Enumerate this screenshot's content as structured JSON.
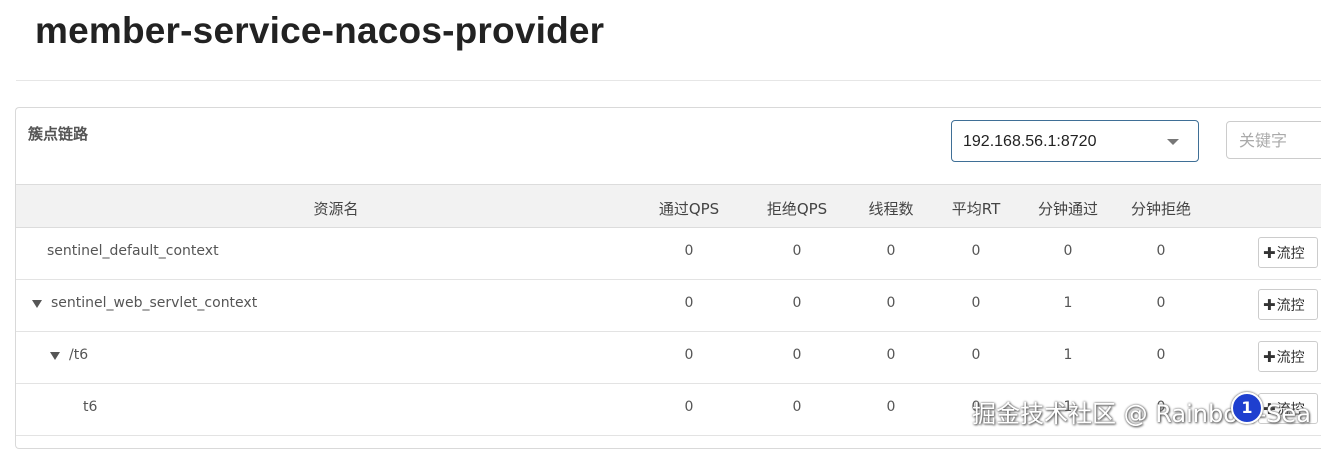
{
  "page": {
    "title": "member-service-nacos-provider"
  },
  "panel": {
    "title": "簇点链路",
    "machine_select": {
      "value": "192.168.56.1:8720"
    },
    "search": {
      "placeholder": "关键字"
    }
  },
  "table": {
    "headers": [
      "资源名",
      "通过QPS",
      "拒绝QPS",
      "线程数",
      "平均RT",
      "分钟通过",
      "分钟拒绝"
    ],
    "rows": [
      {
        "name": "sentinel_default_context",
        "expanded": null,
        "values": [
          "0",
          "0",
          "0",
          "0",
          "0",
          "0"
        ],
        "action": "流控"
      },
      {
        "name": "sentinel_web_servlet_context",
        "expanded": true,
        "values": [
          "0",
          "0",
          "0",
          "0",
          "1",
          "0"
        ],
        "action": "流控"
      },
      {
        "name": "/t6",
        "expanded": true,
        "values": [
          "0",
          "0",
          "0",
          "0",
          "1",
          "0"
        ],
        "action": "流控"
      },
      {
        "name": "t6",
        "expanded": null,
        "values": [
          "0",
          "0",
          "0",
          "0",
          "1",
          "0"
        ],
        "action": "流控"
      }
    ]
  },
  "overlay": {
    "watermark": "掘金技术社区 @ Rainbow-Sea",
    "badge_count": "1"
  },
  "colors": {
    "select_border": "#3f6f96",
    "header_bg": "#f2f2f2",
    "badge": "#1e3fcf"
  }
}
